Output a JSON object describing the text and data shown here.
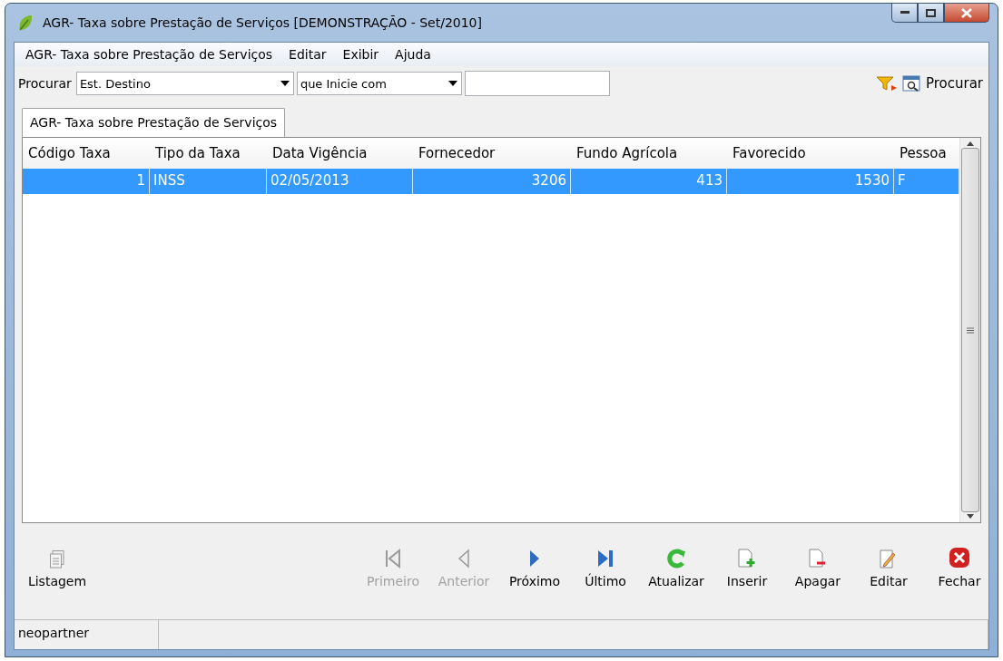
{
  "window": {
    "title": "AGR- Taxa sobre Prestação de Serviços [DEMONSTRAÇÃO - Set/2010]"
  },
  "menu": [
    "AGR- Taxa sobre Prestação de Serviços",
    "Editar",
    "Exibir",
    "Ajuda"
  ],
  "search": {
    "label": "Procurar",
    "field": "Est. Destino",
    "condition": "que Inicie com",
    "button": "Procurar"
  },
  "tabs": [
    {
      "label": "AGR- Taxa sobre Prestação de Serviços",
      "selected": true
    }
  ],
  "table": {
    "columns": [
      {
        "label": "Código Taxa",
        "kind": "number"
      },
      {
        "label": "Tipo da Taxa",
        "kind": "text"
      },
      {
        "label": "Data Vigência",
        "kind": "text"
      },
      {
        "label": "Fornecedor",
        "kind": "number"
      },
      {
        "label": "Fundo Agrícola",
        "kind": "number"
      },
      {
        "label": "Favorecido",
        "kind": "number"
      },
      {
        "label": "Pessoa",
        "kind": "text"
      }
    ],
    "rows": [
      {
        "cells": [
          "1",
          "INSS",
          "02/05/2013",
          "3206",
          "413",
          "1530",
          "F"
        ],
        "selected": true
      }
    ]
  },
  "actions": [
    {
      "kind": "list",
      "label": "Listagem",
      "disabled": false
    },
    {
      "kind": "first",
      "label": "Primeiro",
      "disabled": true
    },
    {
      "kind": "prev",
      "label": "Anterior",
      "disabled": true
    },
    {
      "kind": "next",
      "label": "Próximo",
      "disabled": false
    },
    {
      "kind": "last",
      "label": "Último",
      "disabled": false
    },
    {
      "kind": "refresh",
      "label": "Atualizar",
      "disabled": false
    },
    {
      "kind": "insert",
      "label": "Inserir",
      "disabled": false
    },
    {
      "kind": "delete",
      "label": "Apagar",
      "disabled": false
    },
    {
      "kind": "edit",
      "label": "Editar",
      "disabled": false
    },
    {
      "kind": "close",
      "label": "Fechar",
      "disabled": false
    }
  ],
  "status_bar": {
    "user": "neopartner"
  }
}
